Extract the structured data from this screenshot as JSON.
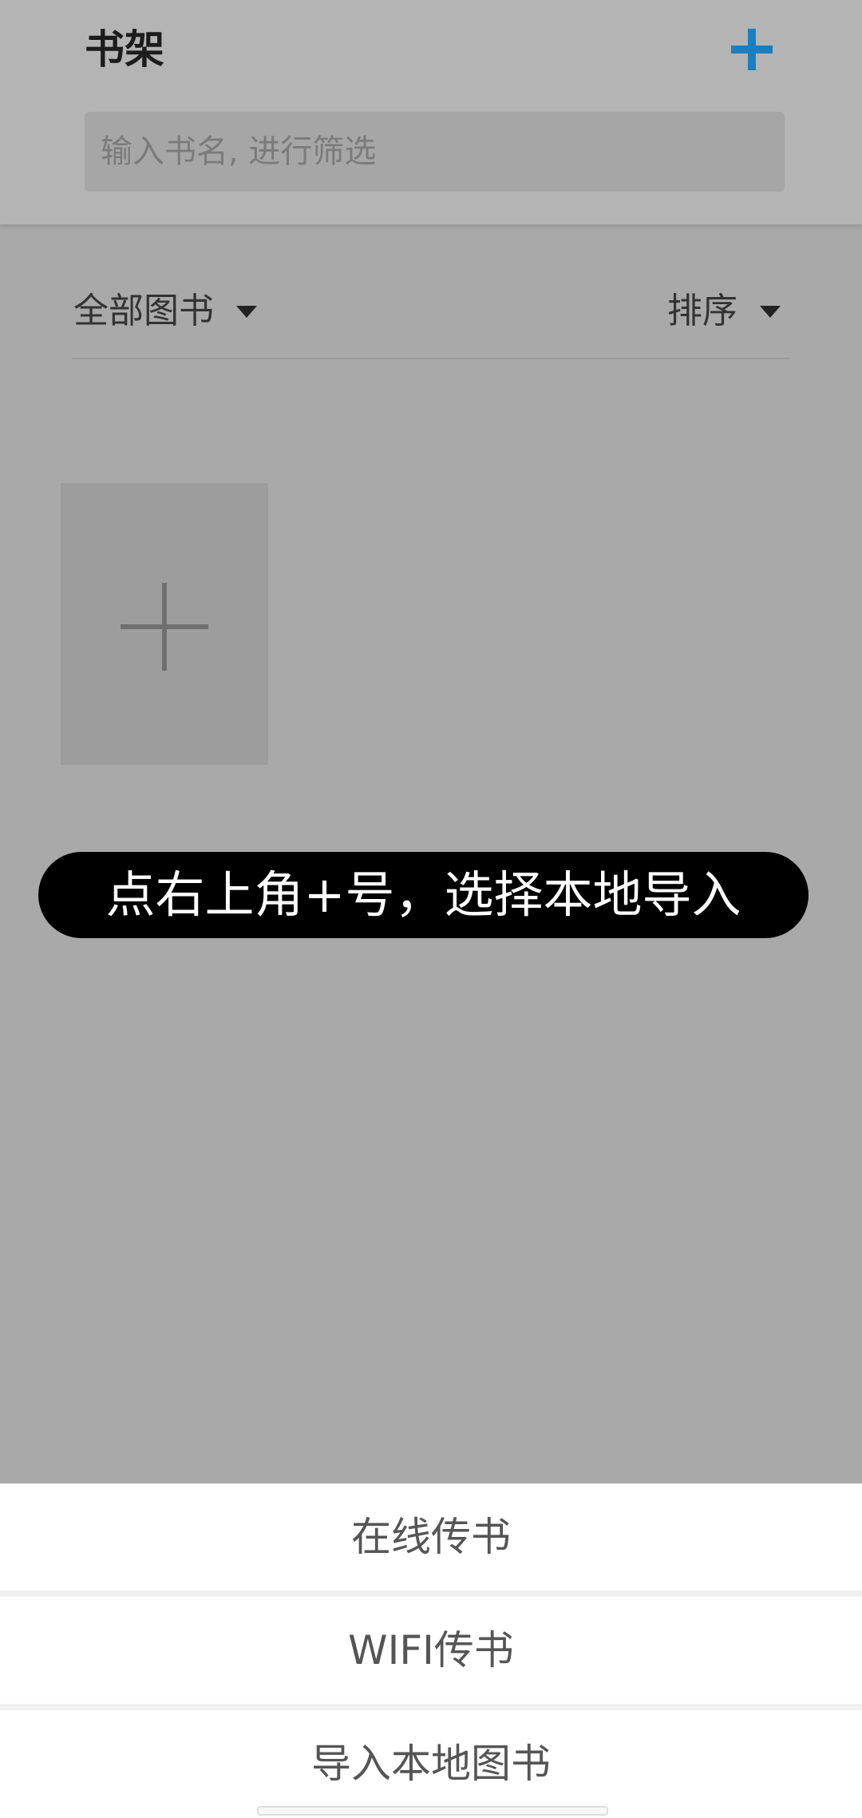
{
  "header": {
    "title": "书架",
    "add_icon": "plus-icon",
    "add_icon_color": "#1a7fc0"
  },
  "search": {
    "placeholder": "输入书名, 进行筛选",
    "value": ""
  },
  "filters": {
    "category_label": "全部图书",
    "sort_label": "排序"
  },
  "grid": {
    "add_tile_icon": "plus-icon"
  },
  "overlay": {
    "caption": "点右上角+号，选择本地导入"
  },
  "sheet": {
    "options": [
      {
        "label": "在线传书"
      },
      {
        "label": "WIFI传书"
      },
      {
        "label": "导入本地图书"
      }
    ]
  }
}
